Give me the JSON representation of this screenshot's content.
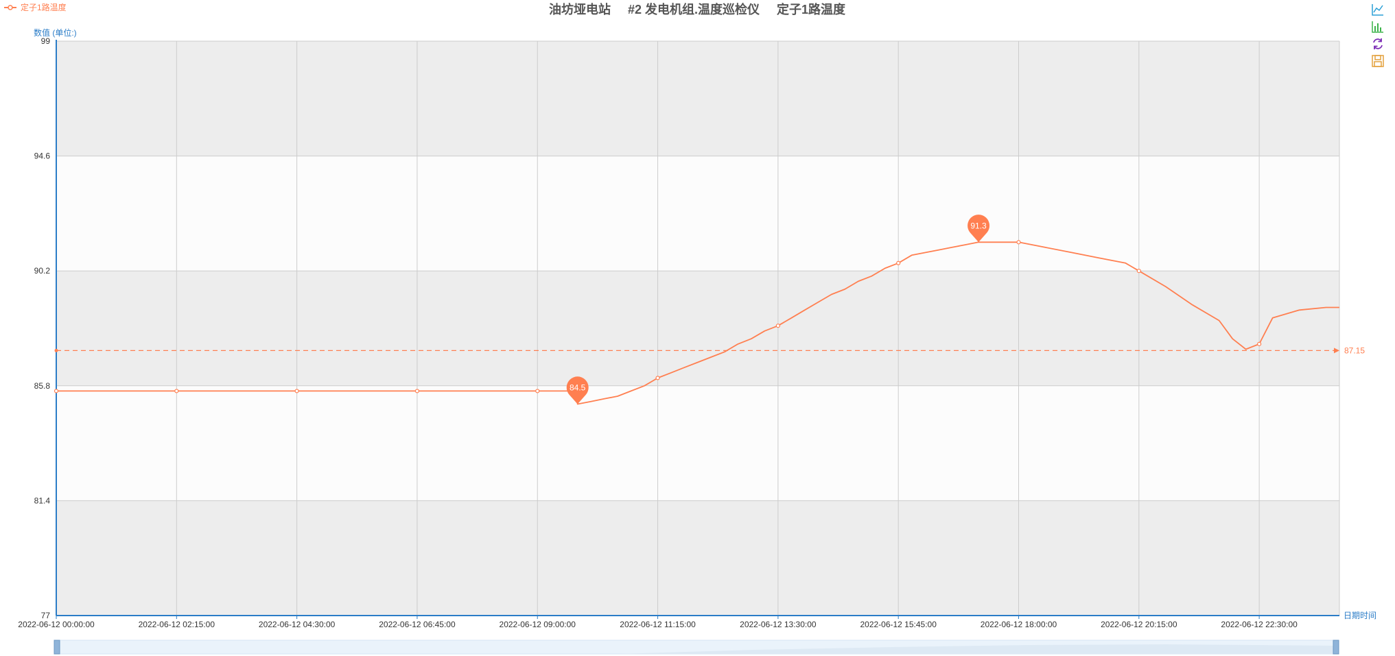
{
  "chart_data": {
    "type": "line",
    "title": "油坊垭电站     #2 发电机组.温度巡检仪     定子1路温度",
    "legend": [
      "定子1路温度"
    ],
    "ylabel": "数值 (单位:)",
    "xlabel": "日期时间",
    "ylim": [
      77,
      99
    ],
    "yticks": [
      "99",
      "94.6",
      "90.2",
      "85.8",
      "81.4",
      "77"
    ],
    "xlim": [
      "2022-06-12 00:00:00",
      "2022-06-13 00:00:00"
    ],
    "xticks": [
      "2022-06-12 00:00:00",
      "2022-06-12 02:15:00",
      "2022-06-12 04:30:00",
      "2022-06-12 06:45:00",
      "2022-06-12 09:00:00",
      "2022-06-12 11:15:00",
      "2022-06-12 13:30:00",
      "2022-06-12 15:45:00",
      "2022-06-12 18:00:00",
      "2022-06-12 20:15:00",
      "2022-06-12 22:30:00"
    ],
    "series": [
      {
        "name": "定子1路温度",
        "color": "#ff7f50",
        "points": [
          [
            "2022-06-12 00:00:00",
            85.6
          ],
          [
            "2022-06-12 02:15:00",
            85.6
          ],
          [
            "2022-06-12 04:30:00",
            85.6
          ],
          [
            "2022-06-12 06:45:00",
            85.6
          ],
          [
            "2022-06-12 09:00:00",
            85.6
          ],
          [
            "2022-06-12 09:45:00",
            85.6
          ],
          [
            "2022-06-12 09:45:00",
            85.1
          ],
          [
            "2022-06-12 10:00:00",
            85.2
          ],
          [
            "2022-06-12 10:15:00",
            85.3
          ],
          [
            "2022-06-12 10:30:00",
            85.4
          ],
          [
            "2022-06-12 10:45:00",
            85.6
          ],
          [
            "2022-06-12 11:00:00",
            85.8
          ],
          [
            "2022-06-12 11:15:00",
            86.1
          ],
          [
            "2022-06-12 11:30:00",
            86.3
          ],
          [
            "2022-06-12 11:45:00",
            86.5
          ],
          [
            "2022-06-12 12:00:00",
            86.7
          ],
          [
            "2022-06-12 12:15:00",
            86.9
          ],
          [
            "2022-06-12 12:30:00",
            87.1
          ],
          [
            "2022-06-12 12:45:00",
            87.4
          ],
          [
            "2022-06-12 13:00:00",
            87.6
          ],
          [
            "2022-06-12 13:15:00",
            87.9
          ],
          [
            "2022-06-12 13:30:00",
            88.1
          ],
          [
            "2022-06-12 13:45:00",
            88.4
          ],
          [
            "2022-06-12 14:00:00",
            88.7
          ],
          [
            "2022-06-12 14:15:00",
            89.0
          ],
          [
            "2022-06-12 14:30:00",
            89.3
          ],
          [
            "2022-06-12 14:45:00",
            89.5
          ],
          [
            "2022-06-12 15:00:00",
            89.8
          ],
          [
            "2022-06-12 15:15:00",
            90.0
          ],
          [
            "2022-06-12 15:30:00",
            90.3
          ],
          [
            "2022-06-12 15:45:00",
            90.5
          ],
          [
            "2022-06-12 16:00:00",
            90.8
          ],
          [
            "2022-06-12 16:15:00",
            90.9
          ],
          [
            "2022-06-12 16:30:00",
            91.0
          ],
          [
            "2022-06-12 16:45:00",
            91.1
          ],
          [
            "2022-06-12 17:00:00",
            91.2
          ],
          [
            "2022-06-12 17:15:00",
            91.3
          ],
          [
            "2022-06-12 18:00:00",
            91.3
          ],
          [
            "2022-06-12 18:30:00",
            91.1
          ],
          [
            "2022-06-12 19:00:00",
            90.9
          ],
          [
            "2022-06-12 19:30:00",
            90.7
          ],
          [
            "2022-06-12 20:00:00",
            90.5
          ],
          [
            "2022-06-12 20:15:00",
            90.2
          ],
          [
            "2022-06-12 20:45:00",
            89.6
          ],
          [
            "2022-06-12 21:15:00",
            88.9
          ],
          [
            "2022-06-12 21:45:00",
            88.3
          ],
          [
            "2022-06-12 22:00:00",
            87.6
          ],
          [
            "2022-06-12 22:15:00",
            87.2
          ],
          [
            "2022-06-12 22:30:00",
            87.4
          ],
          [
            "2022-06-12 22:45:00",
            88.4
          ],
          [
            "2022-06-12 23:15:00",
            88.7
          ],
          [
            "2022-06-12 23:45:00",
            88.8
          ],
          [
            "2022-06-13 00:00:00",
            88.8
          ]
        ]
      }
    ],
    "markPoints": [
      {
        "label": "84.5",
        "x": "2022-06-12 09:45:00",
        "y": 85.1
      },
      {
        "label": "91.3",
        "x": "2022-06-12 17:15:00",
        "y": 91.3
      }
    ],
    "markLine": {
      "label": "87.15",
      "value": 87.15
    },
    "grid": true,
    "legend_position": "top-left",
    "toolbox": [
      "line-chart-icon",
      "bar-chart-icon",
      "restore-icon",
      "save-image-icon"
    ]
  }
}
